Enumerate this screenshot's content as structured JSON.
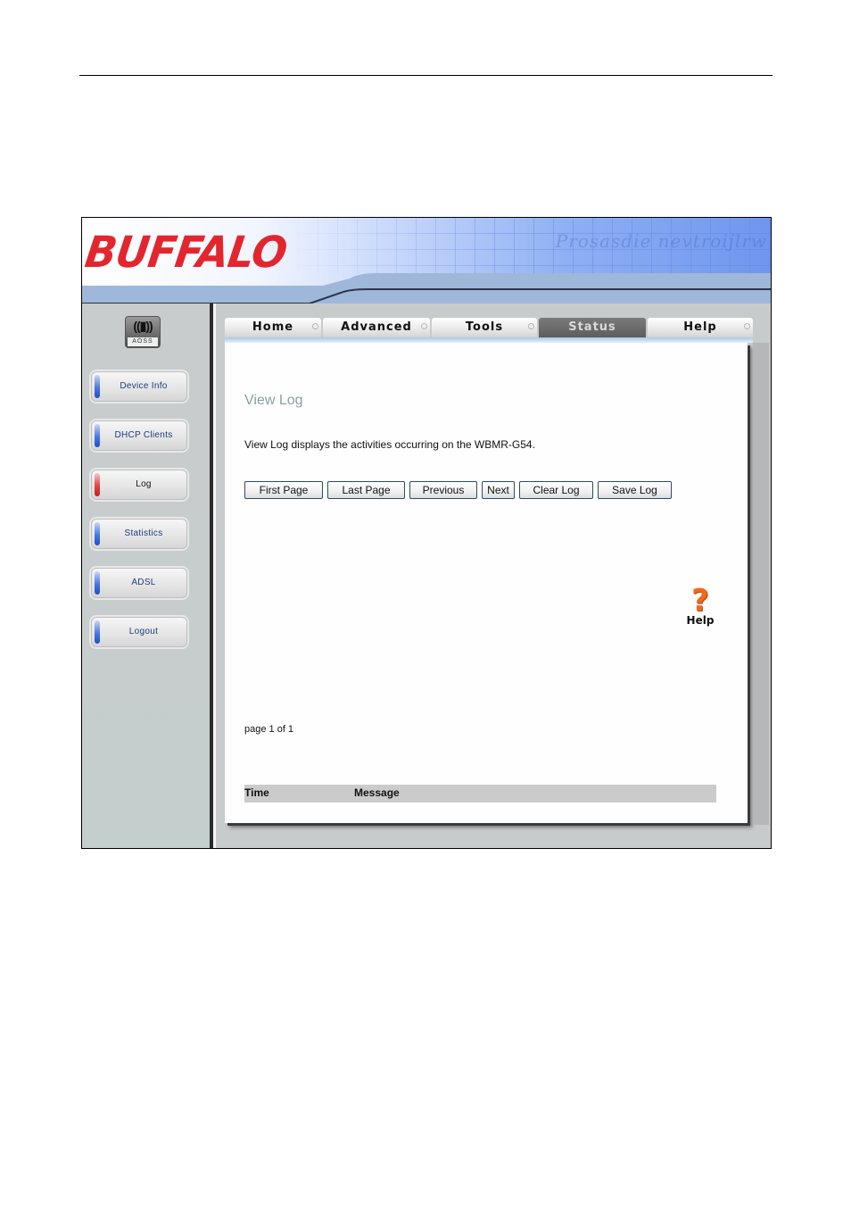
{
  "brand": {
    "logo_text": "BUFFALO",
    "banner_script": "Prosasdie nevtroijlrw"
  },
  "aoss": {
    "label": "AOSS",
    "icon": "aoss-antenna-icon"
  },
  "sidebar": {
    "items": [
      {
        "label": "Device Info",
        "active": false
      },
      {
        "label": "DHCP Clients",
        "active": false
      },
      {
        "label": "Log",
        "active": true
      },
      {
        "label": "Statistics",
        "active": false
      },
      {
        "label": "ADSL",
        "active": false
      },
      {
        "label": "Logout",
        "active": false
      }
    ]
  },
  "tabs": [
    {
      "label": "Home",
      "active": false
    },
    {
      "label": "Advanced",
      "active": false
    },
    {
      "label": "Tools",
      "active": false
    },
    {
      "label": "Status",
      "active": true
    },
    {
      "label": "Help",
      "active": false
    }
  ],
  "main": {
    "title": "View Log",
    "description": "View Log displays the activities occurring on the WBMR-G54.",
    "buttons": {
      "first_page": "First Page",
      "last_page": "Last Page",
      "previous": "Previous",
      "next": "Next",
      "clear_log": "Clear Log",
      "save_log": "Save Log"
    },
    "help_label": "Help",
    "help_glyph": "?",
    "page_info": "page 1 of 1",
    "table": {
      "columns": [
        "Time",
        "Message"
      ],
      "rows": []
    }
  },
  "colors": {
    "logo_red": "#e3262e",
    "active_tab": "#5d5d5d",
    "title_gray_blue": "#8a9ea8",
    "help_orange": "#ee6a1c",
    "table_header": "#cbcbcb"
  }
}
